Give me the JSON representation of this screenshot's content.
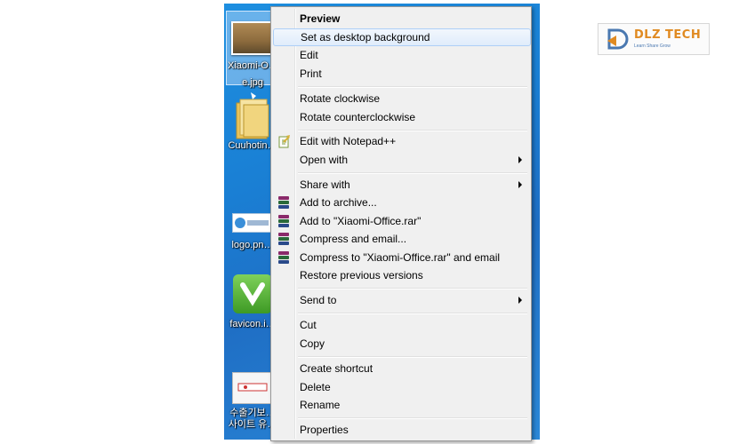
{
  "desktop": {
    "icons": [
      {
        "label": "Xiaomi-O…",
        "label2": "e.jpg"
      },
      {
        "label": "Cuuhotin…"
      },
      {
        "label": "logo.pn…"
      },
      {
        "label": "favicon.i…"
      },
      {
        "label": "수출기보…",
        "label2": "사이트 유…"
      }
    ]
  },
  "menu": {
    "items": [
      {
        "label": "Preview"
      },
      {
        "label": "Set as desktop background"
      },
      {
        "label": "Edit"
      },
      {
        "label": "Print"
      },
      {
        "label": "Rotate clockwise"
      },
      {
        "label": "Rotate counterclockwise"
      },
      {
        "label": "Edit with Notepad++"
      },
      {
        "label": "Open with"
      },
      {
        "label": "Share with"
      },
      {
        "label": "Add to archive..."
      },
      {
        "label": "Add to \"Xiaomi-Office.rar\""
      },
      {
        "label": "Compress and email..."
      },
      {
        "label": "Compress to \"Xiaomi-Office.rar\" and email"
      },
      {
        "label": "Restore previous versions"
      },
      {
        "label": "Send to"
      },
      {
        "label": "Cut"
      },
      {
        "label": "Copy"
      },
      {
        "label": "Create shortcut"
      },
      {
        "label": "Delete"
      },
      {
        "label": "Rename"
      },
      {
        "label": "Properties"
      }
    ]
  },
  "brand": {
    "name": "DLZ TECH",
    "tagline": "Learn Share Grow",
    "colors": {
      "orange": "#e08a21",
      "blue": "#4a78b0"
    }
  }
}
